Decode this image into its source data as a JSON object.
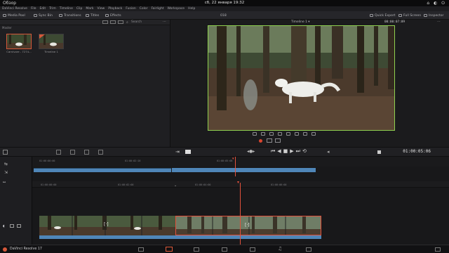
{
  "os": {
    "left": "Обзор",
    "center": "сб, 22 января  19:32",
    "right": "⌂ ◐ ⏻"
  },
  "menu": [
    "DaVinci Resolve",
    "File",
    "Edit",
    "Trim",
    "Timeline",
    "Clip",
    "Mark",
    "View",
    "Playback",
    "Fusion",
    "Color",
    "Fairlight",
    "Workspace",
    "Help"
  ],
  "toolbar": {
    "media_pool": "Media Pool",
    "sync_bin": "Sync Bin",
    "transitions": "Transitions",
    "titles": "Titles",
    "effects": "Effects",
    "project": "018",
    "quick_export": "Quick Export",
    "full_screen": "Full Screen",
    "inspector": "Inspector"
  },
  "pool": {
    "search_placeholder": "Search",
    "master": "Master",
    "clips": [
      {
        "label": "Carnivore - 7274..."
      },
      {
        "label": "Timeline 1"
      }
    ]
  },
  "viewer": {
    "timeline_name": "Timeline 1 ▾",
    "timecode_top": "00:00:07:09"
  },
  "transport": {
    "timecode": "01:00:05:06"
  },
  "ruler_top": [
    "01:00:00:00",
    "01:00:02:16",
    "01:00:05:08"
  ],
  "ruler_main": [
    "01:00:00:00",
    "01:00:02:00",
    "01:00:04:00",
    "01:00:06:00"
  ],
  "app": {
    "name": "DaVinci Resolve 17"
  },
  "colors": {
    "accent": "#e05a3a",
    "viewer_border": "#8fd14f",
    "clip_blue": "#4f86b8",
    "playhead": "#e2513c"
  }
}
